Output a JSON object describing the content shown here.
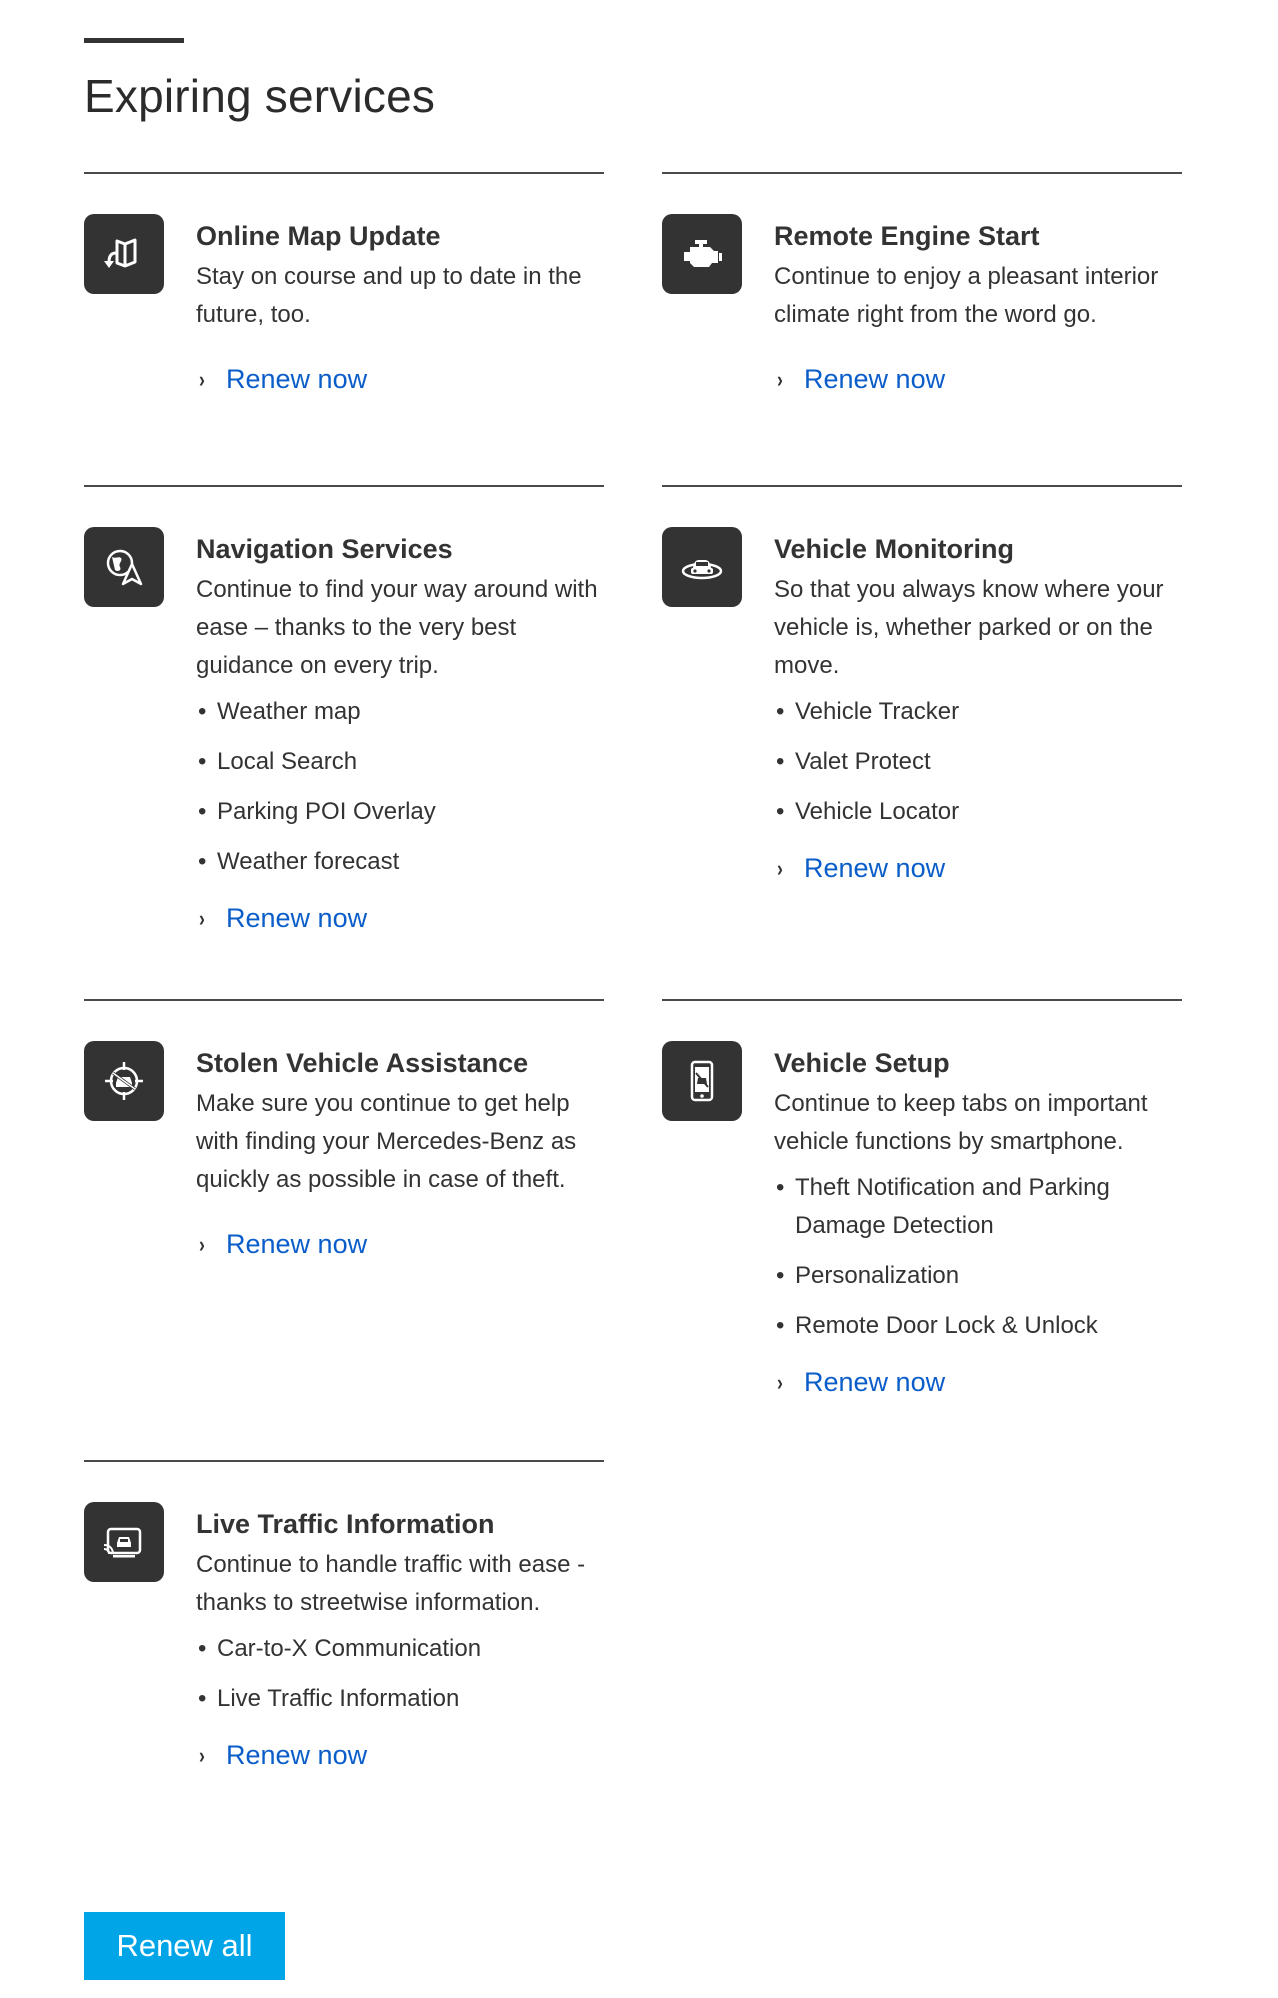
{
  "page": {
    "title": "Expiring services"
  },
  "services": [
    {
      "id": "online-map-update",
      "icon": "map-update-icon",
      "name": "Online Map Update",
      "description": "Stay on course and up to date in the future, too.",
      "features": [],
      "renew_label": "Renew now"
    },
    {
      "id": "remote-engine-start",
      "icon": "engine-icon",
      "name": "Remote Engine Start",
      "description": "Continue to enjoy a pleasant interior climate right from the word go.",
      "features": [],
      "renew_label": "Renew now"
    },
    {
      "id": "navigation-services",
      "icon": "globe-navigation-icon",
      "name": "Navigation Services",
      "description": "Continue to find your way around with ease – thanks to the very best guidance on every trip.",
      "features": [
        "Weather map",
        "Local Search",
        "Parking POI Overlay",
        "Weather forecast"
      ],
      "renew_label": "Renew now"
    },
    {
      "id": "vehicle-monitoring",
      "icon": "car-monitoring-icon",
      "name": "Vehicle Monitoring",
      "description": "So that you always know where your vehicle is, whether parked or on the move.",
      "features": [
        "Vehicle Tracker",
        "Valet Protect",
        "Vehicle Locator"
      ],
      "renew_label": "Renew now"
    },
    {
      "id": "stolen-vehicle-assistance",
      "icon": "crosshair-car-icon",
      "name": "Stolen Vehicle Assistance",
      "description": "Make sure you continue to get help with finding your Mercedes-Benz as quickly as possible in case of theft.",
      "features": [],
      "renew_label": "Renew now"
    },
    {
      "id": "vehicle-setup",
      "icon": "smartphone-icon",
      "name": "Vehicle Setup",
      "description": "Continue to keep tabs on important vehicle functions by smartphone.",
      "features": [
        "Theft Notification and Parking Damage Detection",
        "Personalization",
        "Remote Door Lock & Unlock"
      ],
      "renew_label": "Renew now"
    },
    {
      "id": "live-traffic-information",
      "icon": "traffic-screen-icon",
      "name": "Live Traffic Information",
      "description": "Continue to handle traffic with ease - thanks to streetwise information.",
      "features": [
        "Car-to-X Communication",
        "Live Traffic Information"
      ],
      "renew_label": "Renew now"
    }
  ],
  "footer": {
    "renew_all_label": "Renew all"
  },
  "colors": {
    "text": "#333333",
    "link": "#0b5ec9",
    "icon_tile": "#333333",
    "primary_button": "#00a5e8"
  }
}
